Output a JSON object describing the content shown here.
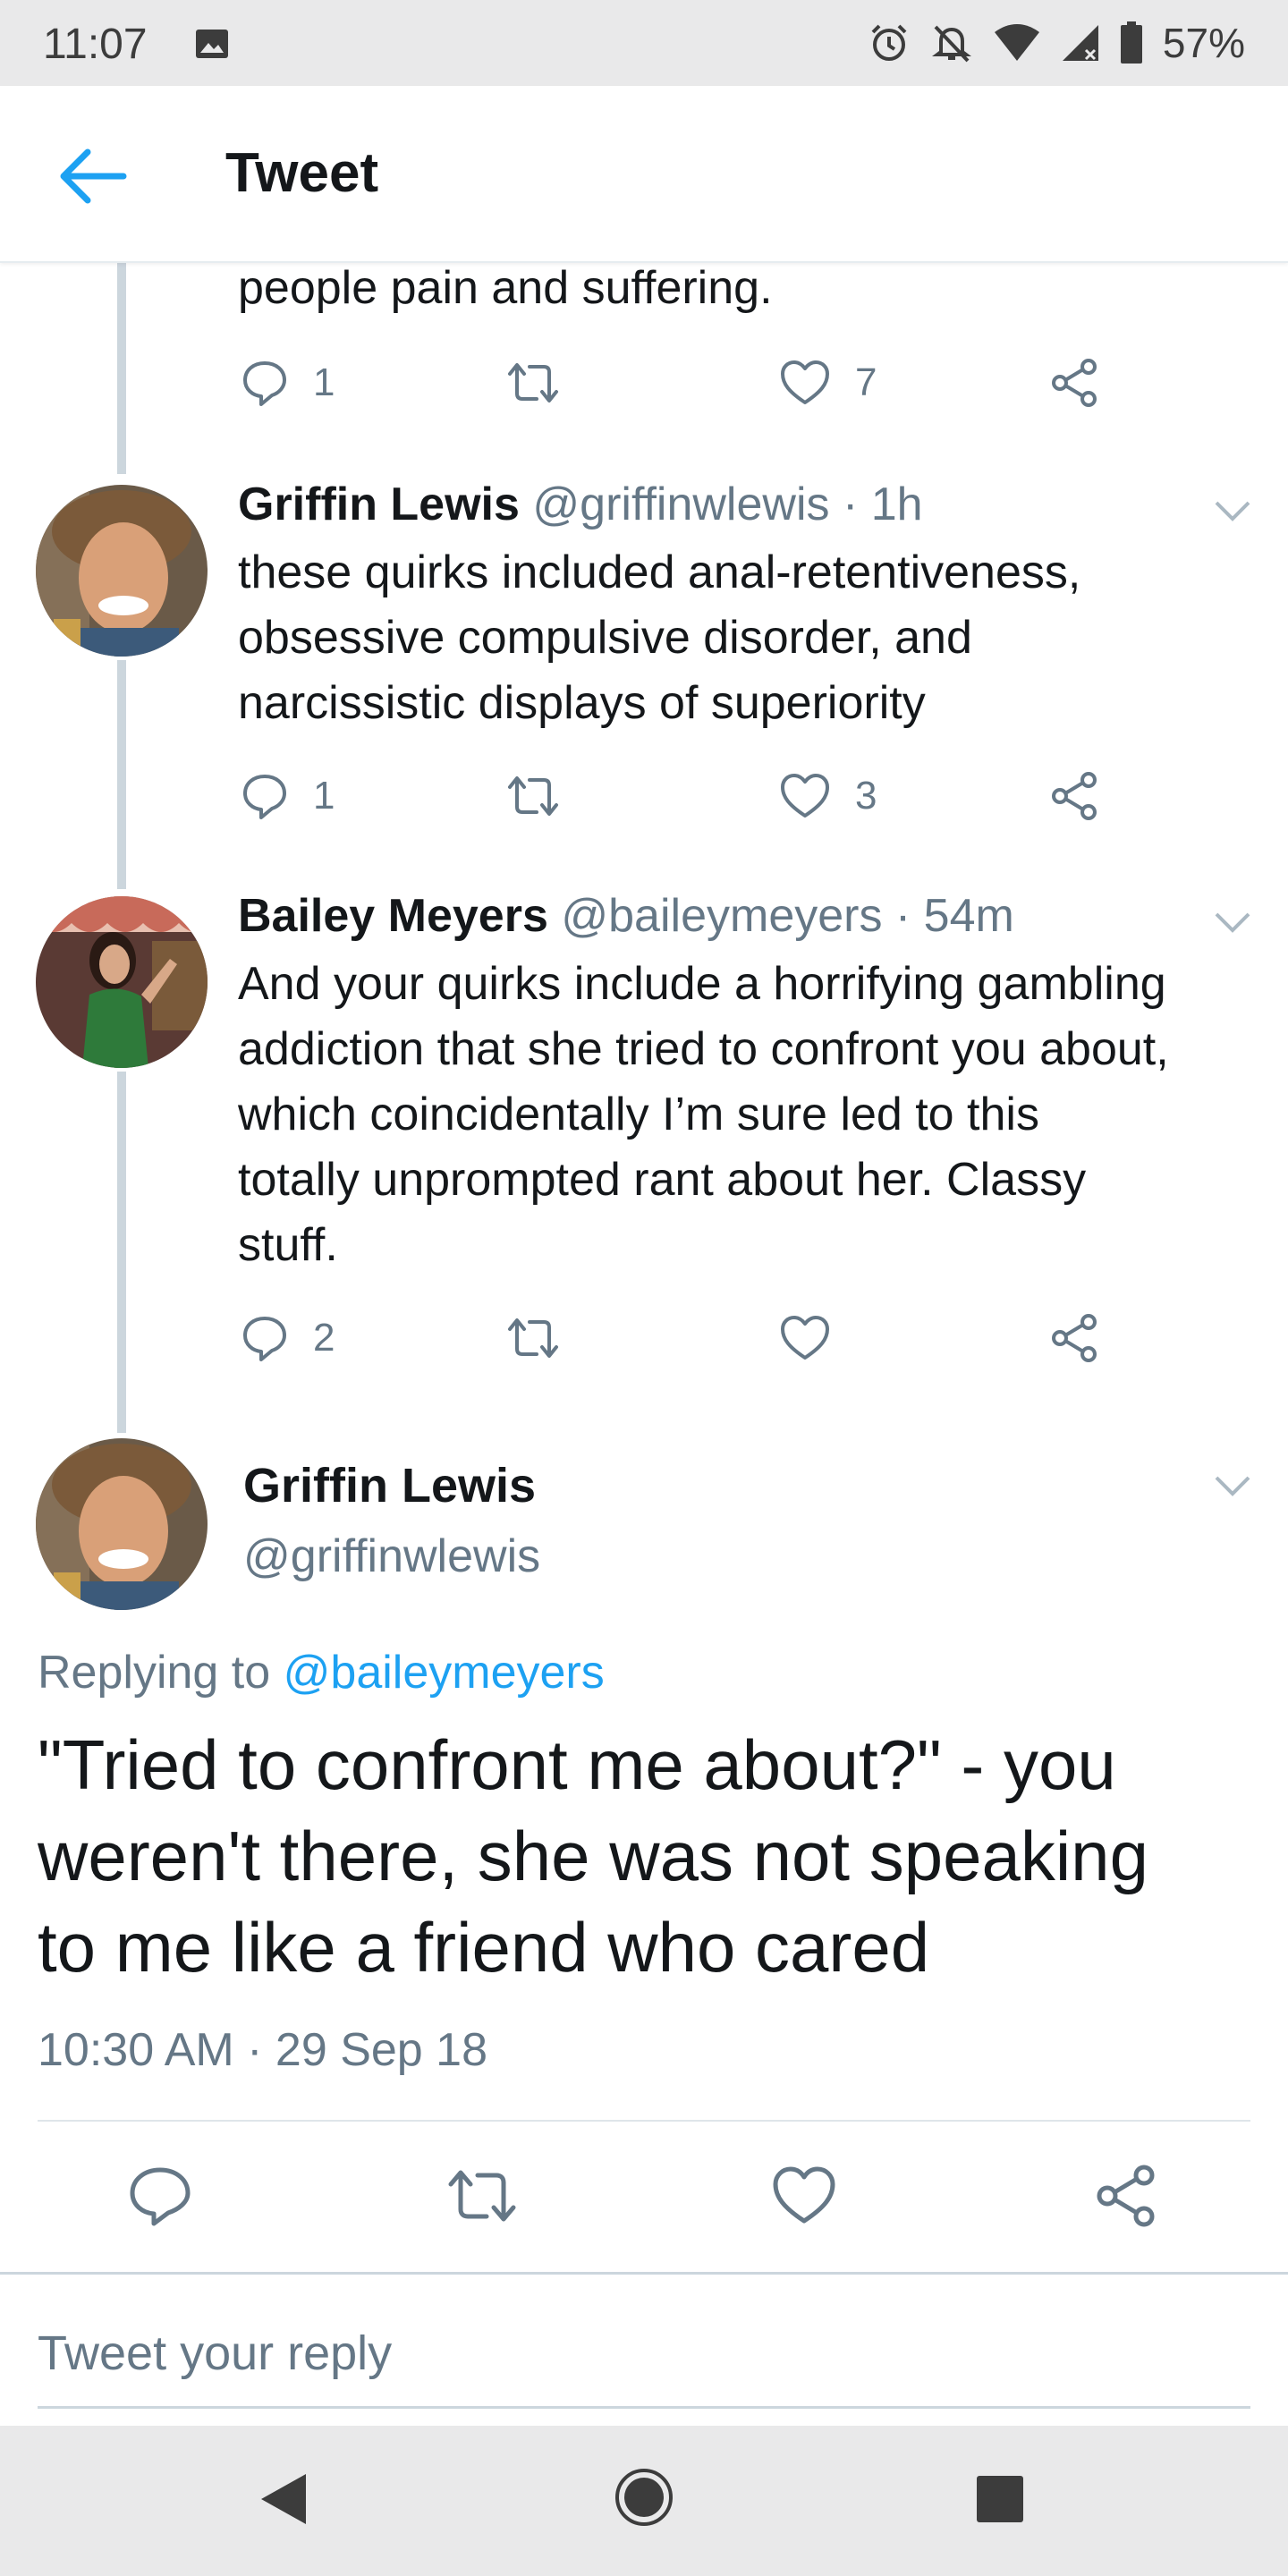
{
  "status_bar": {
    "time": "11:07",
    "battery_percent": "57%",
    "icons": [
      "image-icon",
      "alarm-icon",
      "bell-off-icon",
      "wifi-icon",
      "signal-icon",
      "battery-icon"
    ]
  },
  "header": {
    "title": "Tweet",
    "back_icon": "arrow-left-icon"
  },
  "thread": {
    "top_fragment": {
      "text": "people pain and suffering.",
      "reply_count": "1",
      "retweet_count": "",
      "like_count": "7"
    },
    "tweets": [
      {
        "name": "Griffin Lewis",
        "handle_time": "@griffinwlewis · 1h",
        "lines": [
          "these quirks included anal-retentiveness,",
          "obsessive compulsive disorder, and",
          "narcissistic displays of superiority"
        ],
        "reply_count": "1",
        "retweet_count": "",
        "like_count": "3"
      },
      {
        "name": "Bailey Meyers",
        "handle_time": "@baileymeyers · 54m",
        "lines": [
          "And your quirks include a horrifying gambling",
          "addiction that she tried to confront you about,",
          "which coincidentally I’m sure led to this",
          "totally unprompted rant about her. Classy",
          "stuff."
        ],
        "reply_count": "2",
        "retweet_count": "",
        "like_count": ""
      }
    ]
  },
  "main_tweet": {
    "name": "Griffin Lewis",
    "handle": "@griffinwlewis",
    "replying_prefix": "Replying to ",
    "replying_to": "@baileymeyers",
    "lines": [
      "\"Tried to confront me about?\" - you",
      "weren't there, she was not speaking",
      "to me like a friend who cared"
    ],
    "timestamp": "10:30 AM · 29 Sep 18"
  },
  "compose": {
    "placeholder": "Tweet your reply"
  },
  "nav_bar": {
    "icons": [
      "back-triangle-icon",
      "home-circle-icon",
      "recents-square-icon"
    ]
  },
  "colors": {
    "accent": "#1da1f2",
    "secondary_text": "#657786",
    "thread_line": "#ccd6dd",
    "system_bar": "#e9e9ea"
  }
}
